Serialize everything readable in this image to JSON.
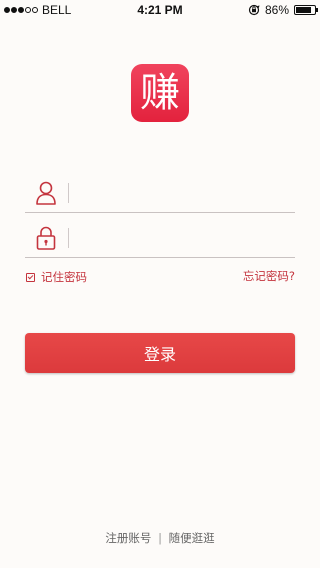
{
  "status_bar": {
    "carrier": "BELL",
    "time": "4:21 PM",
    "battery_percent": "86%",
    "battery_level": 0.86,
    "signal_bars_filled": 3,
    "signal_bars_total": 5
  },
  "logo": {
    "glyph": "赚",
    "color": "#e8304a"
  },
  "login_form": {
    "username_placeholder": "",
    "password_placeholder": "",
    "remember_label": "记住密码",
    "forgot_label": "忘记密码?",
    "submit_label": "登录"
  },
  "footer": {
    "register_label": "注册账号",
    "separator": "|",
    "browse_label": "随便逛逛"
  },
  "colors": {
    "accent": "#e03f41",
    "link": "#c4343e",
    "background": "#fdfbf9"
  },
  "icons": {
    "username": "user-icon",
    "password": "lock-icon",
    "orientation": "orientation-lock-icon",
    "battery": "battery-icon"
  }
}
